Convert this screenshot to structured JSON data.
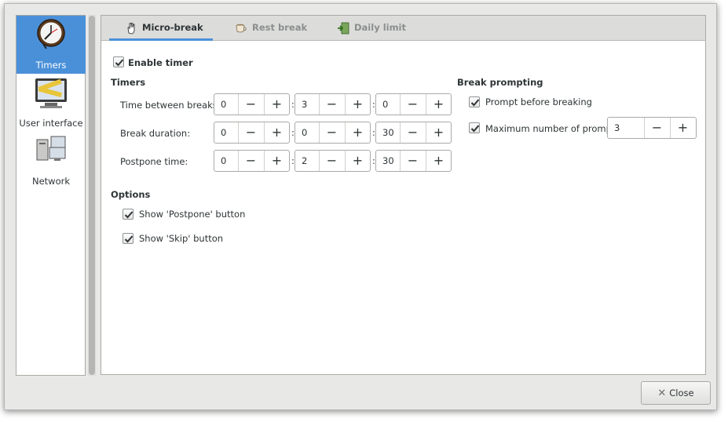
{
  "sidebar": {
    "items": [
      {
        "label": "Timers",
        "icon": "clock-icon",
        "selected": true
      },
      {
        "label": "User interface",
        "icon": "ruler-monitor-icon",
        "selected": false
      },
      {
        "label": "Network",
        "icon": "network-computers-icon",
        "selected": false
      }
    ]
  },
  "tabs": [
    {
      "label": "Micro-break",
      "icon": "hand-icon",
      "active": true
    },
    {
      "label": "Rest break",
      "icon": "coffee-cup-icon",
      "active": false
    },
    {
      "label": "Daily limit",
      "icon": "exit-door-icon",
      "active": false
    }
  ],
  "enable_timer": {
    "label": "Enable timer",
    "checked": true
  },
  "timers": {
    "heading": "Timers",
    "rows": [
      {
        "label": "Time between breaks:",
        "h": "0",
        "m": "3",
        "s": "0"
      },
      {
        "label": "Break duration:",
        "h": "0",
        "m": "0",
        "s": "30"
      },
      {
        "label": "Postpone time:",
        "h": "0",
        "m": "2",
        "s": "30"
      }
    ],
    "separator": ":",
    "minus": "−",
    "plus": "+"
  },
  "options": {
    "heading": "Options",
    "show_postpone": {
      "label": "Show 'Postpone' button",
      "checked": true
    },
    "show_skip": {
      "label": "Show 'Skip' button",
      "checked": true
    }
  },
  "prompting": {
    "heading": "Break prompting",
    "prompt_before": {
      "label": "Prompt before breaking",
      "checked": true
    },
    "max_prompts": {
      "label": "Maximum number of prompts:",
      "checked": true,
      "value": "3"
    }
  },
  "close_button": {
    "label": "Close",
    "icon": "close-x-icon"
  },
  "colors": {
    "accent": "#4a90d9",
    "window_bg": "#e8e8e7"
  }
}
